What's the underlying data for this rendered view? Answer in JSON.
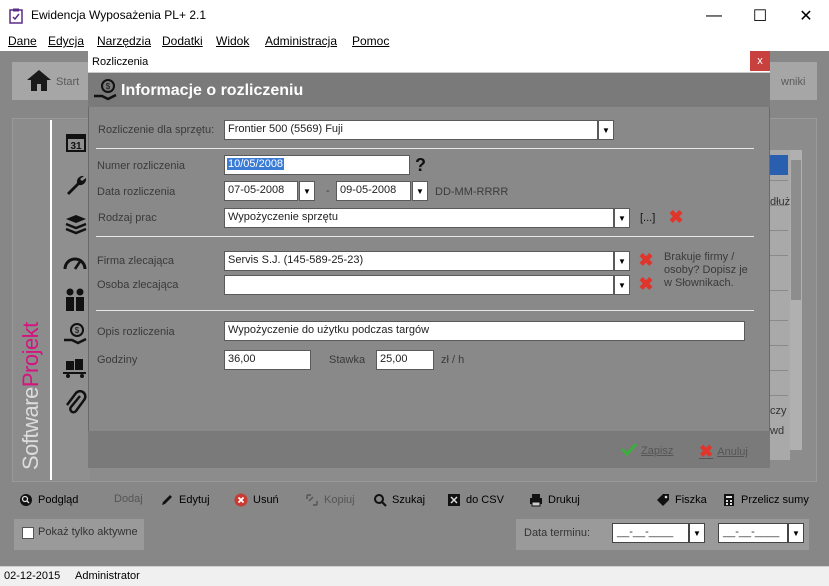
{
  "app": {
    "title": "Ewidencja Wyposażenia PL+ 2.1",
    "window_controls": {
      "minimize": "—",
      "maximize": "☐",
      "close": "✕"
    }
  },
  "menu": [
    "Dane",
    "Edycja",
    "Narzędzia",
    "Dodatki",
    "Widok",
    "Administracja",
    "Pomoc"
  ],
  "background": {
    "start_label": "Start",
    "right_label": "wniki",
    "brand_prefix": "Software",
    "brand_suffix": "Projekt",
    "list_fragments": [
      "dłuż",
      "czy",
      "wd"
    ]
  },
  "bottom_toolbar": [
    {
      "label": "Podgląd",
      "icon": "search-icon",
      "enabled": true
    },
    {
      "label": "Dodaj",
      "icon": "",
      "enabled": false
    },
    {
      "label": "Edytuj",
      "icon": "pencil-icon",
      "enabled": true
    },
    {
      "label": "Usuń",
      "icon": "delete-icon",
      "enabled": true
    },
    {
      "label": "Kopiuj",
      "icon": "copy-icon",
      "enabled": false
    },
    {
      "label": "Szukaj",
      "icon": "magnifier-icon",
      "enabled": true
    },
    {
      "label": "do CSV",
      "icon": "excel-icon",
      "enabled": true
    },
    {
      "label": "Drukuj",
      "icon": "printer-icon",
      "enabled": true
    },
    {
      "label": "Fiszka",
      "icon": "tag-icon",
      "enabled": true
    },
    {
      "label": "Przelicz sumy",
      "icon": "calculator-icon",
      "enabled": true
    }
  ],
  "filter": {
    "only_active_label": "Pokaż tylko aktywne",
    "deadline_label": "Data terminu:",
    "date_placeholder": "__-__-____"
  },
  "status": {
    "date": "02-12-2015",
    "user": "Administrator"
  },
  "dialog": {
    "window_title": "Rozliczenia",
    "close": "x",
    "heading": "Informacje o rozliczeniu",
    "equipment_label": "Rozliczenie dla sprzętu:",
    "equipment_value": "Frontier 500 (5569) Fuji",
    "number_label": "Numer rozliczenia",
    "number_value": "10/05/2008",
    "help_mark": "?",
    "date_label": "Data rozliczenia",
    "date_from": "07-05-2008",
    "date_sep": "-",
    "date_to": "09-05-2008",
    "date_format": "DD-MM-RRRR",
    "work_type_label": "Rodzaj prac",
    "work_type_value": "Wypożyczenie sprzętu",
    "ellipsis_btn": "[...]",
    "company_label": "Firma zlecająca",
    "company_value": "Servis S.J. (145-589-25-23)",
    "person_label": "Osoba zlecająca",
    "person_value": "",
    "missing_hint": "Brakuje firmy / osoby? Dopisz je w Słownikach.",
    "description_label": "Opis rozliczenia",
    "description_value": "Wypożyczenie do użytku podczas targów",
    "hours_label": "Godziny",
    "hours_value": "36,00",
    "rate_label": "Stawka",
    "rate_value": "25,00",
    "rate_unit": "zł / h",
    "save_label": "Zapisz",
    "cancel_label": "Anuluj"
  },
  "colors": {
    "accent_red": "#e0352b",
    "selection_blue": "#3a7bd5",
    "save_green": "#3cae3c",
    "brand_pink": "#d4147f"
  }
}
